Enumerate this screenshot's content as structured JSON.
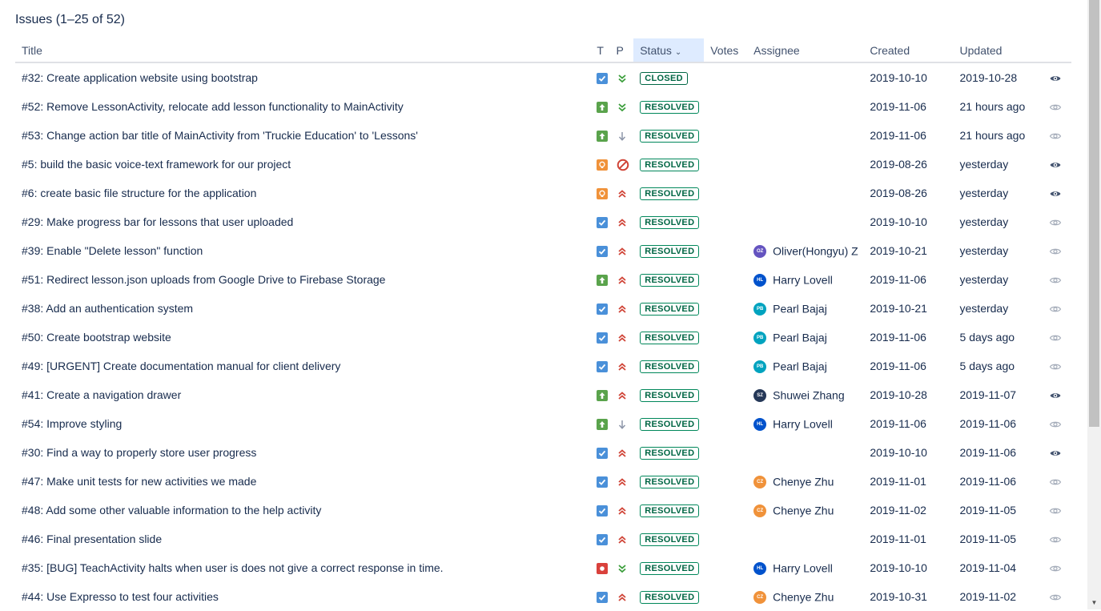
{
  "header": {
    "title": "Issues (1–25 of 52)"
  },
  "table": {
    "columns": {
      "title": "Title",
      "type": "T",
      "priority": "P",
      "status": "Status",
      "votes": "Votes",
      "assignee": "Assignee",
      "created": "Created",
      "updated": "Updated"
    },
    "sort": {
      "column": "Status",
      "direction": "descending",
      "icon": "chevron-down-icon"
    },
    "rows": [
      {
        "title": "#32: Create application website using bootstrap",
        "type": "task",
        "priority": "trivial",
        "status": "CLOSED",
        "votes": "",
        "assignee": "",
        "initials": "",
        "avatar_color": "",
        "created": "2019-10-10",
        "updated": "2019-10-28",
        "watching": true
      },
      {
        "title": "#52: Remove LessonActivity, relocate add lesson functionality to MainActivity",
        "type": "improvement",
        "priority": "trivial",
        "status": "RESOLVED",
        "votes": "",
        "assignee": "",
        "initials": "",
        "avatar_color": "",
        "created": "2019-11-06",
        "updated": "21 hours ago",
        "watching": false
      },
      {
        "title": "#53: Change action bar title of MainActivity from 'Truckie Education' to 'Lessons'",
        "type": "improvement",
        "priority": "minor",
        "status": "RESOLVED",
        "votes": "",
        "assignee": "",
        "initials": "",
        "avatar_color": "",
        "created": "2019-11-06",
        "updated": "21 hours ago",
        "watching": false
      },
      {
        "title": "#5: build the basic voice-text framework for our project",
        "type": "proposal",
        "priority": "blocker",
        "status": "RESOLVED",
        "votes": "",
        "assignee": "",
        "initials": "",
        "avatar_color": "",
        "created": "2019-08-26",
        "updated": "yesterday",
        "watching": true
      },
      {
        "title": "#6: create basic file structure for the application",
        "type": "proposal",
        "priority": "critical",
        "status": "RESOLVED",
        "votes": "",
        "assignee": "",
        "initials": "",
        "avatar_color": "",
        "created": "2019-08-26",
        "updated": "yesterday",
        "watching": true
      },
      {
        "title": "#29: Make progress bar for lessons that user uploaded",
        "type": "task",
        "priority": "critical",
        "status": "RESOLVED",
        "votes": "",
        "assignee": "",
        "initials": "",
        "avatar_color": "",
        "created": "2019-10-10",
        "updated": "yesterday",
        "watching": false
      },
      {
        "title": "#39: Enable \"Delete lesson\" function",
        "type": "task",
        "priority": "critical",
        "status": "RESOLVED",
        "votes": "",
        "assignee": "Oliver(Hongyu) Z",
        "initials": "OZ",
        "avatar_color": "#6554c0",
        "created": "2019-10-21",
        "updated": "yesterday",
        "watching": false
      },
      {
        "title": "#51: Redirect lesson.json uploads from Google Drive to Firebase Storage",
        "type": "improvement",
        "priority": "critical",
        "status": "RESOLVED",
        "votes": "",
        "assignee": "Harry Lovell",
        "initials": "HL",
        "avatar_color": "#0052cc",
        "created": "2019-11-06",
        "updated": "yesterday",
        "watching": false
      },
      {
        "title": "#38: Add an authentication system",
        "type": "task",
        "priority": "critical",
        "status": "RESOLVED",
        "votes": "",
        "assignee": "Pearl Bajaj",
        "initials": "PB",
        "avatar_color": "#00a3bf",
        "created": "2019-10-21",
        "updated": "yesterday",
        "watching": false
      },
      {
        "title": "#50: Create bootstrap website",
        "type": "task",
        "priority": "critical",
        "status": "RESOLVED",
        "votes": "",
        "assignee": "Pearl Bajaj",
        "initials": "PB",
        "avatar_color": "#00a3bf",
        "created": "2019-11-06",
        "updated": "5 days ago",
        "watching": false
      },
      {
        "title": "#49: [URGENT] Create documentation manual for client delivery",
        "type": "task",
        "priority": "critical",
        "status": "RESOLVED",
        "votes": "",
        "assignee": "Pearl Bajaj",
        "initials": "PB",
        "avatar_color": "#00a3bf",
        "created": "2019-11-06",
        "updated": "5 days ago",
        "watching": false
      },
      {
        "title": "#41: Create a navigation drawer",
        "type": "improvement",
        "priority": "critical",
        "status": "RESOLVED",
        "votes": "",
        "assignee": "Shuwei Zhang",
        "initials": "SZ",
        "avatar_color": "#253858",
        "created": "2019-10-28",
        "updated": "2019-11-07",
        "watching": true
      },
      {
        "title": "#54: Improve styling",
        "type": "improvement",
        "priority": "minor",
        "status": "RESOLVED",
        "votes": "",
        "assignee": "Harry Lovell",
        "initials": "HL",
        "avatar_color": "#0052cc",
        "created": "2019-11-06",
        "updated": "2019-11-06",
        "watching": false
      },
      {
        "title": "#30: Find a way to properly store user progress",
        "type": "task",
        "priority": "critical",
        "status": "RESOLVED",
        "votes": "",
        "assignee": "",
        "initials": "",
        "avatar_color": "",
        "created": "2019-10-10",
        "updated": "2019-11-06",
        "watching": true
      },
      {
        "title": "#47: Make unit tests for new activities we made",
        "type": "task",
        "priority": "critical",
        "status": "RESOLVED",
        "votes": "",
        "assignee": "Chenye Zhu",
        "initials": "CZ",
        "avatar_color": "#f0923a",
        "created": "2019-11-01",
        "updated": "2019-11-06",
        "watching": false
      },
      {
        "title": "#48: Add some other valuable information to the help activity",
        "type": "task",
        "priority": "critical",
        "status": "RESOLVED",
        "votes": "",
        "assignee": "Chenye Zhu",
        "initials": "CZ",
        "avatar_color": "#f0923a",
        "created": "2019-11-02",
        "updated": "2019-11-05",
        "watching": false
      },
      {
        "title": "#46: Final presentation slide",
        "type": "task",
        "priority": "critical",
        "status": "RESOLVED",
        "votes": "",
        "assignee": "",
        "initials": "",
        "avatar_color": "",
        "created": "2019-11-01",
        "updated": "2019-11-05",
        "watching": false
      },
      {
        "title": "#35: [BUG] TeachActivity halts when user is does not give a correct response in time.",
        "type": "bug",
        "priority": "trivial",
        "status": "RESOLVED",
        "votes": "",
        "assignee": "Harry Lovell",
        "initials": "HL",
        "avatar_color": "#0052cc",
        "created": "2019-10-10",
        "updated": "2019-11-04",
        "watching": false
      },
      {
        "title": "#44: Use Expresso to test four activities",
        "type": "task",
        "priority": "critical",
        "status": "RESOLVED",
        "votes": "",
        "assignee": "Chenye Zhu",
        "initials": "CZ",
        "avatar_color": "#f0923a",
        "created": "2019-10-31",
        "updated": "2019-11-02",
        "watching": false
      }
    ]
  },
  "colors": {
    "resolved_border": "#00875a",
    "sorted_header_bg": "#deebff",
    "priority_critical": "#d04437",
    "priority_trivial": "#3b9e3b",
    "priority_minor": "#8c95a8",
    "watch_active": "#42526e",
    "watch_inactive": "#a5adba"
  }
}
